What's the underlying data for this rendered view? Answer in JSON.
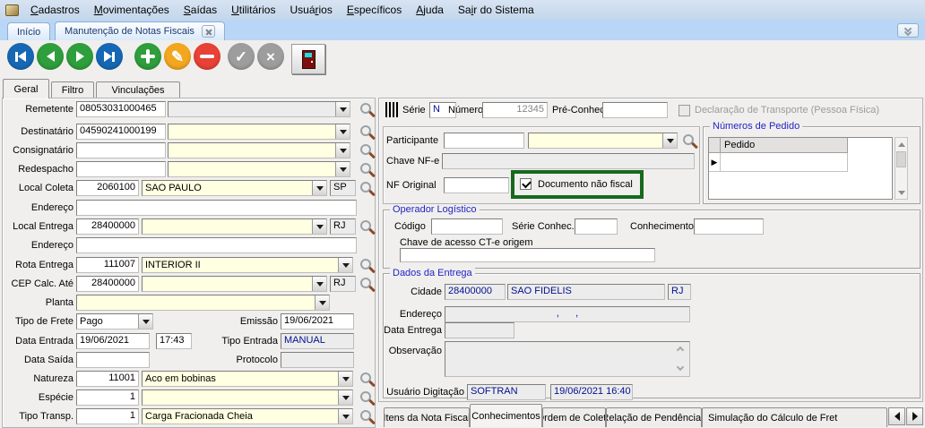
{
  "menu": {
    "items": [
      {
        "pre": "",
        "key": "C",
        "post": "adastros"
      },
      {
        "pre": "",
        "key": "M",
        "post": "ovimentações"
      },
      {
        "pre": "",
        "key": "S",
        "post": "aídas"
      },
      {
        "pre": "",
        "key": "U",
        "post": "tilitários"
      },
      {
        "pre": "Usuá",
        "key": "r",
        "post": "ios"
      },
      {
        "pre": "",
        "key": "E",
        "post": "specíficos"
      },
      {
        "pre": "",
        "key": "A",
        "post": "juda"
      },
      {
        "pre": "Sa",
        "key": "i",
        "post": "r do Sistema"
      }
    ]
  },
  "window_tabs": {
    "inicio": "Início",
    "manutencao": "Manutenção de Notas Fiscais"
  },
  "page_tabs": {
    "geral": "Geral",
    "filtro": "Filtro",
    "vinculacoes": "Vinculações"
  },
  "form_left": {
    "remetente": {
      "label": "Remetente",
      "code": "08053031000465",
      "desc": ""
    },
    "destinatario": {
      "label": "Destinatário",
      "code": "04590241000199",
      "desc": ""
    },
    "consignatario": {
      "label": "Consignatário",
      "code": "",
      "desc": ""
    },
    "redespacho": {
      "label": "Redespacho",
      "code": "",
      "desc": ""
    },
    "local_coleta": {
      "label": "Local Coleta",
      "code": "2060100",
      "desc": "SAO PAULO",
      "uf": "SP"
    },
    "endereco1": {
      "label": "Endereço",
      "value": ""
    },
    "local_entrega": {
      "label": "Local Entrega",
      "code": "28400000",
      "desc": "",
      "uf": "RJ"
    },
    "endereco2": {
      "label": "Endereço",
      "value": ""
    },
    "rota_entrega": {
      "label": "Rota Entrega",
      "code": "111007",
      "desc": "INTERIOR II"
    },
    "cep_calc_ate": {
      "label": "CEP Calc. Até",
      "code": "28400000",
      "desc": "",
      "uf": "RJ"
    },
    "planta": {
      "label": "Planta",
      "desc": ""
    },
    "tipo_frete": {
      "label": "Tipo de Frete",
      "value": "Pago"
    },
    "emissao": {
      "label": "Emissão",
      "value": "19/06/2021"
    },
    "data_entrada": {
      "label": "Data Entrada",
      "date": "19/06/2021",
      "time": "17:43"
    },
    "tipo_entrada": {
      "label": "Tipo Entrada",
      "value": "MANUAL"
    },
    "data_saida": {
      "label": "Data Saída",
      "value": ""
    },
    "protocolo": {
      "label": "Protocolo",
      "value": ""
    },
    "natureza": {
      "label": "Natureza",
      "code": "11001",
      "desc": "Aco em bobinas"
    },
    "especie": {
      "label": "Espécie",
      "code": "1",
      "desc": ""
    },
    "tipo_transp": {
      "label": "Tipo Transp.",
      "code": "1",
      "desc": "Carga Fracionada Cheia"
    }
  },
  "doc": {
    "serie_label": "Série",
    "serie": "N",
    "numero_label": "Número",
    "numero": "12345",
    "pre_conhec_label": "Pré-Conhec.",
    "pre_conhec": "",
    "declaracao": "Declaração de Transporte (Pessoa Física)"
  },
  "participante": {
    "label": "Participante",
    "code": "",
    "desc": ""
  },
  "chave_nfe": {
    "label": "Chave NF-e",
    "value": ""
  },
  "nf_original": {
    "label": "NF Original",
    "value": ""
  },
  "doc_nao_fiscal": {
    "label": "Documento não fiscal",
    "checked": true
  },
  "pedidos": {
    "title": "Números de Pedido",
    "col": "Pedido"
  },
  "operador": {
    "title": "Operador Logístico",
    "codigo_label": "Código",
    "codigo": "",
    "serie_label": "Série Conhec.",
    "serie": "",
    "conhecimento_label": "Conhecimento",
    "conhecimento": "",
    "chave_label": "Chave de acesso CT-e origem",
    "chave": ""
  },
  "entrega": {
    "title": "Dados da Entrega",
    "cidade_label": "Cidade",
    "cep": "28400000",
    "cidade": "SAO FIDELIS",
    "uf": "RJ",
    "endereco_label": "Endereço",
    "endereco": ",      ,",
    "data_label": "Data Entrega",
    "data": "",
    "obs_label": "Observação",
    "obs": "",
    "usuario_label": "Usuário Digitação",
    "usuario": "SOFTRAN",
    "registro": "19/06/2021 16:40"
  },
  "bottom_tabs": {
    "itens": "Itens da Nota Fiscal",
    "conhecimentos": "Conhecimentos",
    "ordem": "Ordem de Coleta",
    "pendencias": "Relação de Pendências",
    "simulacao": "Simulação do Cálculo de Fret"
  },
  "colors": {
    "field_yellow": "#FFFFE1",
    "readonly_gray": "#ECECEC",
    "value_blue": "#000F8F",
    "group_title_blue": "#2323C8",
    "nav_blue": "#1668B5",
    "green": "#2F9E3C",
    "orange": "#F2A71F",
    "red": "#E84135",
    "gray_button": "#9D9D9D",
    "highlight_green": "#17691D",
    "menubar_blue": "#C9DAEE",
    "tabstrip_blue": "#B9D6F6"
  }
}
